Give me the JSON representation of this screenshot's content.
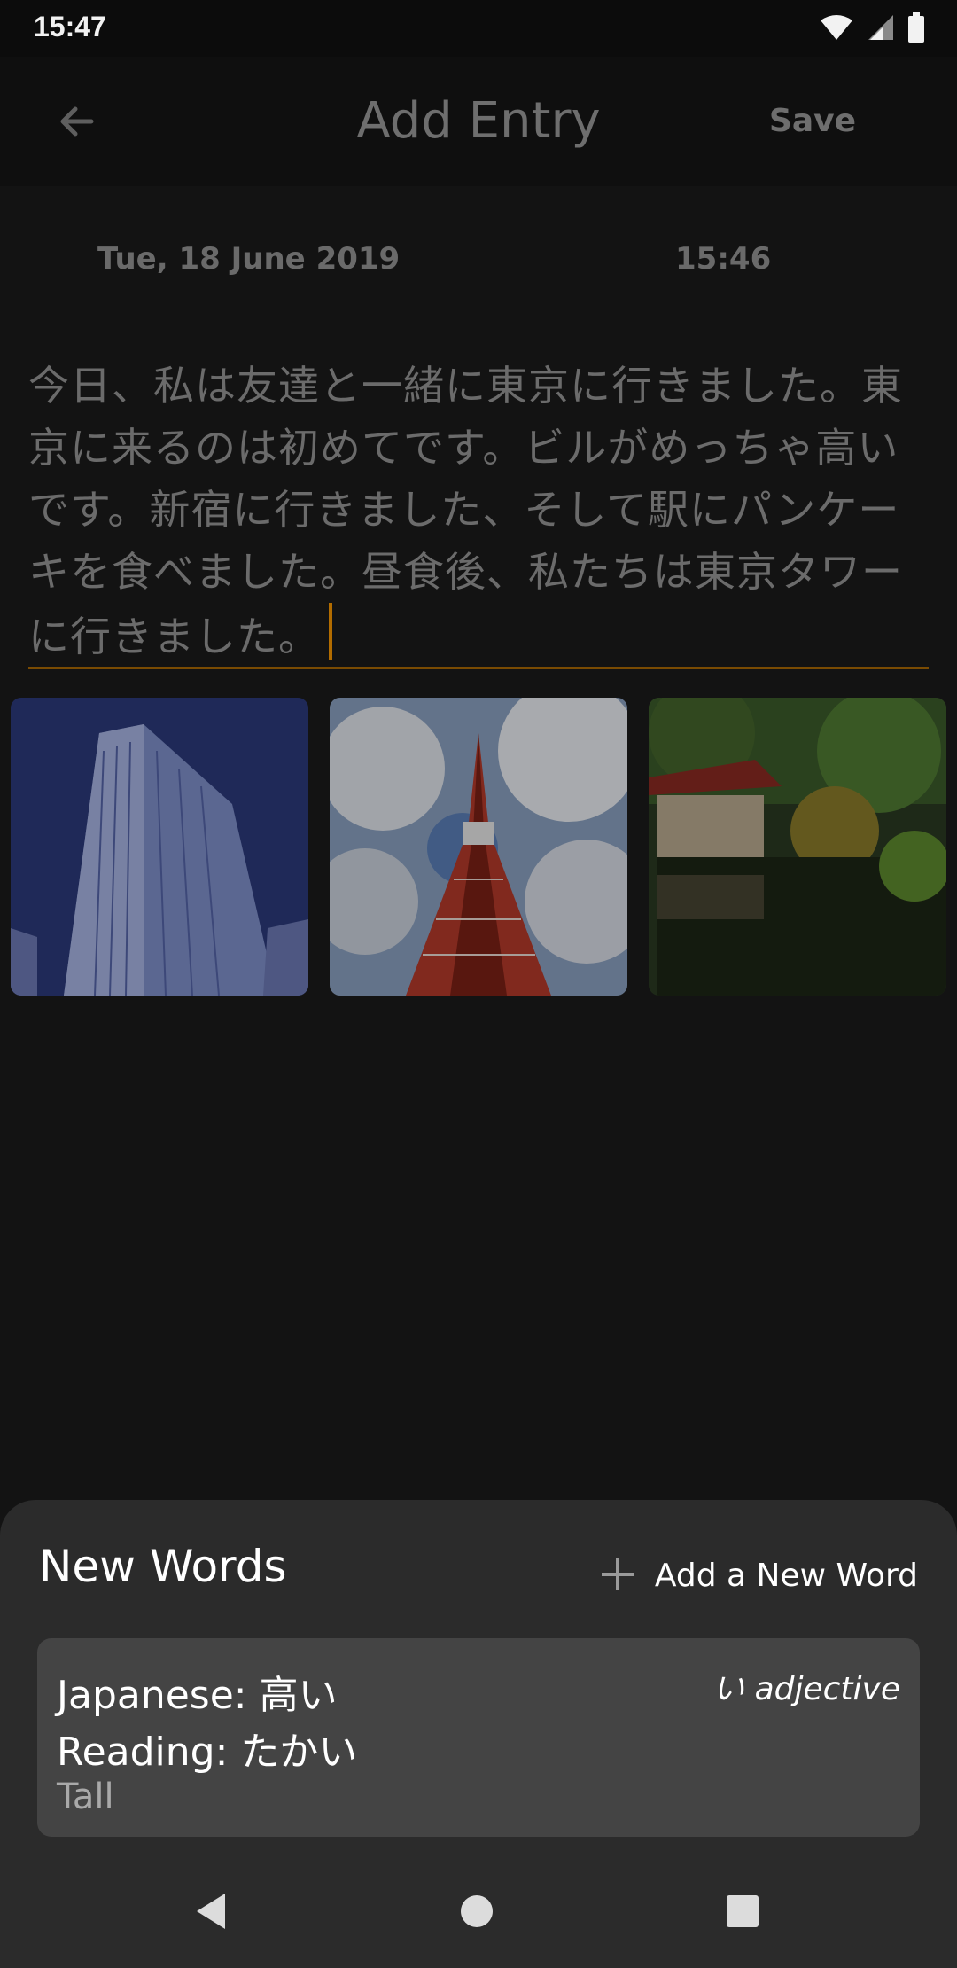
{
  "status_bar": {
    "time": "15:47"
  },
  "app_bar": {
    "title": "Add Entry",
    "save_label": "Save"
  },
  "entry": {
    "date": "Tue, 18 June 2019",
    "time": "15:46",
    "text": "今日、私は友達と一緒に東京に行きました。東京に来るのは初めてです。ビルがめっちゃ高いです。新宿に行きました、そして駅にパンケーキを食べました。昼食後、私たちは東京タワーに行きました。"
  },
  "photos": [
    "building-photo",
    "tokyo-tower-photo",
    "japanese-garden-photo"
  ],
  "new_words": {
    "title": "New Words",
    "add_label": "Add a New Word",
    "words": [
      {
        "japanese": "Japanese: 高い",
        "reading": "Reading: たかい",
        "meaning": "Tall",
        "type": "い adjective"
      }
    ]
  },
  "colors": {
    "accent": "#b26c00",
    "sheet_bg": "#2b2b2b",
    "card_bg": "#444444"
  }
}
